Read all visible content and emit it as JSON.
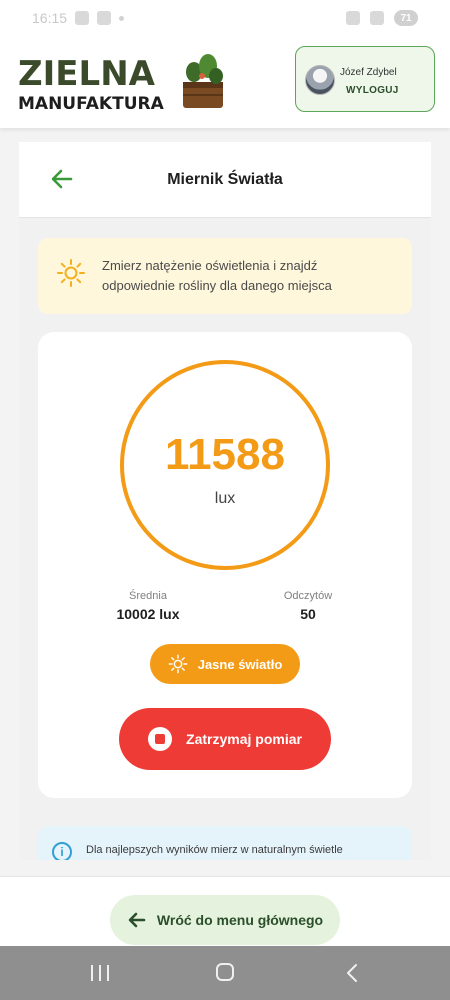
{
  "status_bar": {
    "time": "16:15",
    "battery": "71"
  },
  "header": {
    "logo_line1": "ZIELNA",
    "logo_line2": "MANUFAKTURA",
    "user_name": "Józef Zdybel",
    "logout_label": "WYLOGUJ"
  },
  "page": {
    "title": "Miernik Światła",
    "hint": "Zmierz natężenie oświetlenia i znajdź odpowiednie rośliny dla danego miejsca",
    "reading_value": "11588",
    "reading_unit": "lux",
    "stats": [
      {
        "label": "Średnia",
        "value": "10002 lux"
      },
      {
        "label": "Odczytów",
        "value": "50"
      }
    ],
    "light_level_label": "Jasne światło",
    "stop_button_label": "Zatrzymaj pomiar",
    "tip_text": "Dla najlepszych wyników mierz w naturalnym świetle"
  },
  "footer": {
    "home_button_label": "Wróć do menu głównego"
  },
  "colors": {
    "accent_orange": "#f39b16",
    "stop_red": "#ef3b35",
    "brand_green": "#2b4f2b"
  }
}
